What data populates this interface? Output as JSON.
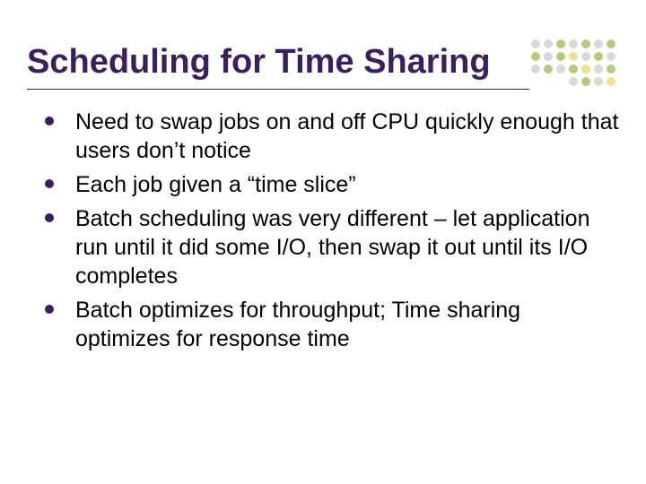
{
  "title": "Scheduling for Time Sharing",
  "bullets": [
    "Need to swap jobs on and off CPU quickly enough that users don’t notice",
    "Each job given a “time slice”",
    "Batch scheduling was very different – let application run until it did some I/O, then swap it out until its I/O completes",
    "Batch optimizes for throughput; Time sharing optimizes for response time"
  ],
  "theme": {
    "title_color": "#3a1e5f",
    "bullet_color": "#3a1e5f",
    "accent_colors": [
      "#b8c97a",
      "#d9d9d9",
      "#f0e28a",
      "#c9c9c9"
    ]
  }
}
